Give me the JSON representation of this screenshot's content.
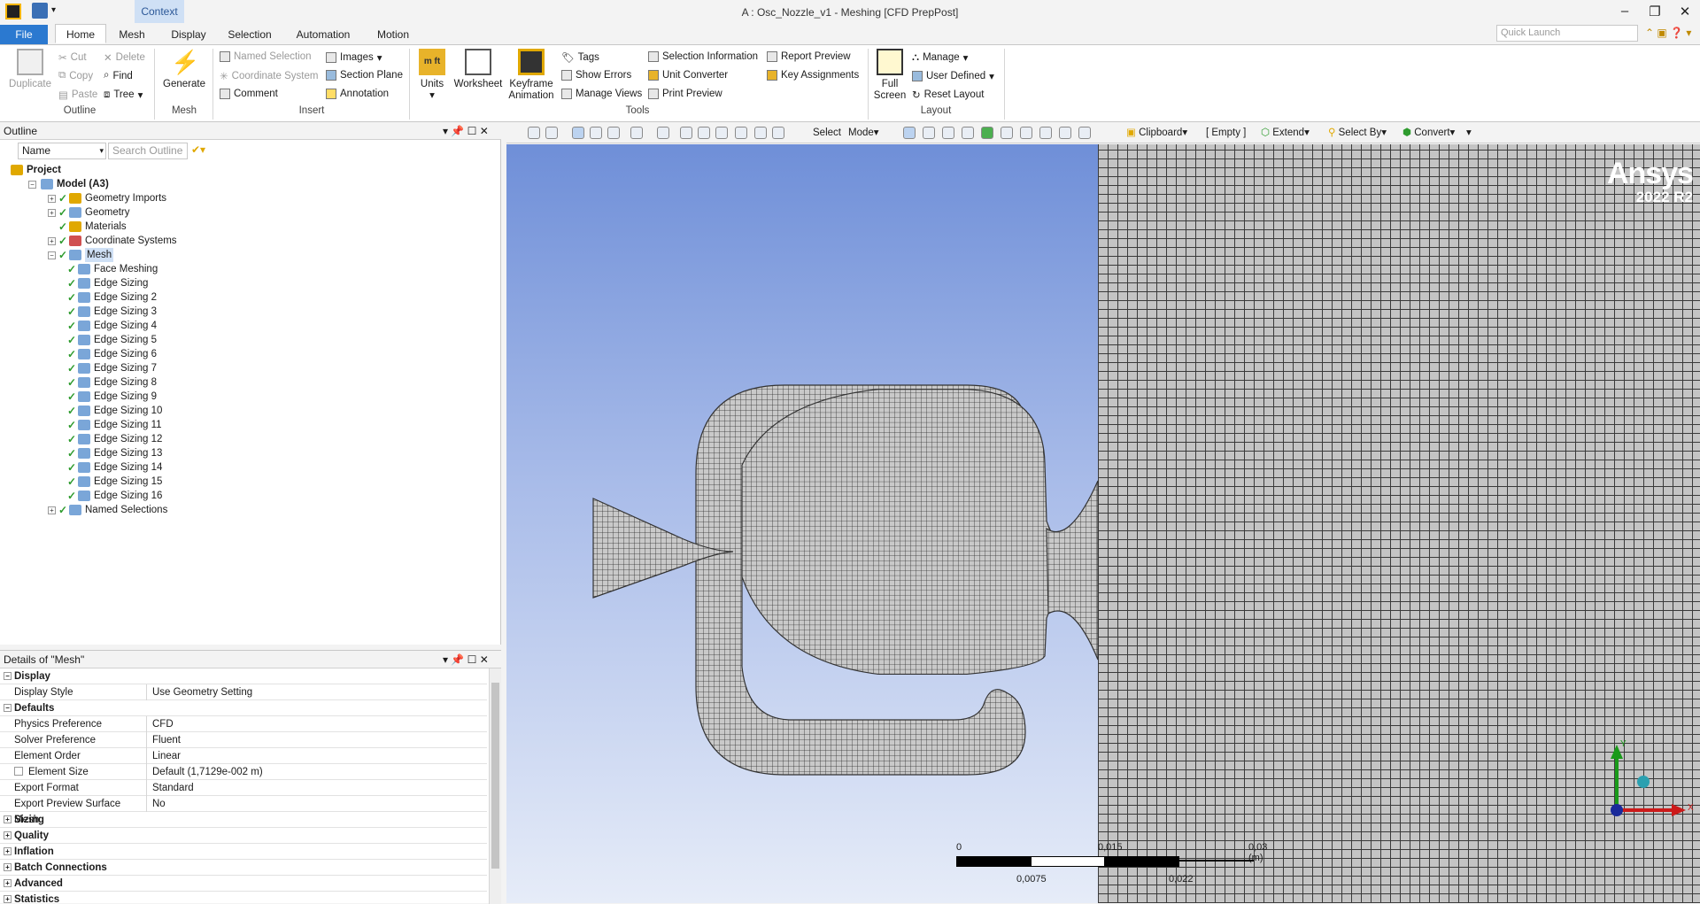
{
  "window": {
    "title": "A : Osc_Nozzle_v1 - Meshing [CFD PrepPost]",
    "context_tab": "Context"
  },
  "tabs": [
    {
      "label": "File"
    },
    {
      "label": "Home"
    },
    {
      "label": "Mesh"
    },
    {
      "label": "Display"
    },
    {
      "label": "Selection"
    },
    {
      "label": "Automation"
    },
    {
      "label": "Motion"
    }
  ],
  "quick_launch": {
    "placeholder": "Quick Launch"
  },
  "ribbon": {
    "outline": {
      "group": "Outline",
      "duplicate": "Duplicate",
      "cut": "Cut",
      "copy": "Copy",
      "paste": "Paste",
      "delete": "Delete",
      "find": "Find",
      "tree": "Tree"
    },
    "mesh": {
      "group": "Mesh",
      "generate": "Generate"
    },
    "insert": {
      "group": "Insert",
      "named_selection": "Named Selection",
      "coordinate_system": "Coordinate System",
      "comment": "Comment",
      "images": "Images",
      "section_plane": "Section Plane",
      "annotation": "Annotation"
    },
    "tools": {
      "group": "Tools",
      "units": "Units",
      "worksheet": "Worksheet",
      "keyframe": "Keyframe",
      "animation": "Animation",
      "tags": "Tags",
      "show_errors": "Show Errors",
      "manage_views": "Manage Views",
      "selection_information": "Selection Information",
      "unit_converter": "Unit Converter",
      "print_preview": "Print Preview",
      "report_preview": "Report Preview",
      "key_assignments": "Key Assignments"
    },
    "layout": {
      "group": "Layout",
      "full": "Full",
      "screen": "Screen",
      "manage": "Manage",
      "user_defined": "User Defined",
      "reset_layout": "Reset Layout"
    }
  },
  "outline": {
    "title": "Outline",
    "filter_name": "Name",
    "search_placeholder": "Search Outline",
    "tree": [
      {
        "label": "Project",
        "level": 0
      },
      {
        "label": "Model (A3)",
        "level": 1
      },
      {
        "label": "Geometry Imports",
        "level": 2
      },
      {
        "label": "Geometry",
        "level": 2
      },
      {
        "label": "Materials",
        "level": 2
      },
      {
        "label": "Coordinate Systems",
        "level": 2
      },
      {
        "label": "Mesh",
        "level": 2
      },
      {
        "label": "Face Meshing",
        "level": 3
      },
      {
        "label": "Edge Sizing",
        "level": 3
      },
      {
        "label": "Edge Sizing 2",
        "level": 3
      },
      {
        "label": "Edge Sizing 3",
        "level": 3
      },
      {
        "label": "Edge Sizing 4",
        "level": 3
      },
      {
        "label": "Edge Sizing 5",
        "level": 3
      },
      {
        "label": "Edge Sizing 6",
        "level": 3
      },
      {
        "label": "Edge Sizing 7",
        "level": 3
      },
      {
        "label": "Edge Sizing 8",
        "level": 3
      },
      {
        "label": "Edge Sizing 9",
        "level": 3
      },
      {
        "label": "Edge Sizing 10",
        "level": 3
      },
      {
        "label": "Edge Sizing 11",
        "level": 3
      },
      {
        "label": "Edge Sizing 12",
        "level": 3
      },
      {
        "label": "Edge Sizing 13",
        "level": 3
      },
      {
        "label": "Edge Sizing 14",
        "level": 3
      },
      {
        "label": "Edge Sizing 15",
        "level": 3
      },
      {
        "label": "Edge Sizing 16",
        "level": 3
      },
      {
        "label": "Named Selections",
        "level": 2
      }
    ]
  },
  "details": {
    "title": "Details of \"Mesh\"",
    "rows": [
      {
        "type": "section",
        "key": "Display"
      },
      {
        "type": "prop",
        "key": "Display Style",
        "value": "Use Geometry Setting"
      },
      {
        "type": "section",
        "key": "Defaults"
      },
      {
        "type": "prop",
        "key": "Physics Preference",
        "value": "CFD"
      },
      {
        "type": "prop",
        "key": "Solver Preference",
        "value": "Fluent"
      },
      {
        "type": "prop",
        "key": "Element Order",
        "value": "Linear"
      },
      {
        "type": "prop",
        "key": "Element Size",
        "value": "Default (1,7129e-002 m)"
      },
      {
        "type": "prop",
        "key": "Export Format",
        "value": "Standard"
      },
      {
        "type": "prop",
        "key": "Export Preview Surface Mesh",
        "value": "No"
      },
      {
        "type": "section",
        "key": "Sizing"
      },
      {
        "type": "section",
        "key": "Quality"
      },
      {
        "type": "section",
        "key": "Inflation"
      },
      {
        "type": "section",
        "key": "Batch Connections"
      },
      {
        "type": "section",
        "key": "Advanced"
      },
      {
        "type": "section",
        "key": "Statistics"
      }
    ]
  },
  "graphics_toolbar": {
    "select": "Select",
    "mode": "Mode",
    "clipboard": "Clipboard",
    "empty": "[ Empty ]",
    "extend": "Extend",
    "select_by": "Select By",
    "convert": "Convert"
  },
  "viewport": {
    "logo_brand": "Ansys",
    "logo_version": "2022 R2",
    "scale": {
      "t0": "0",
      "t1": "0,0075",
      "t2": "0,015",
      "t3": "0,022",
      "t4": "0,03 (m)"
    },
    "triad": {
      "x": "X",
      "y": "Y"
    }
  },
  "colors": {
    "accent": "#2b79d0",
    "context": "#cfe0f5",
    "check": "#2e9b2e",
    "viewport_top": "#6f8fd8",
    "viewport_bottom": "#e6ecf8"
  }
}
